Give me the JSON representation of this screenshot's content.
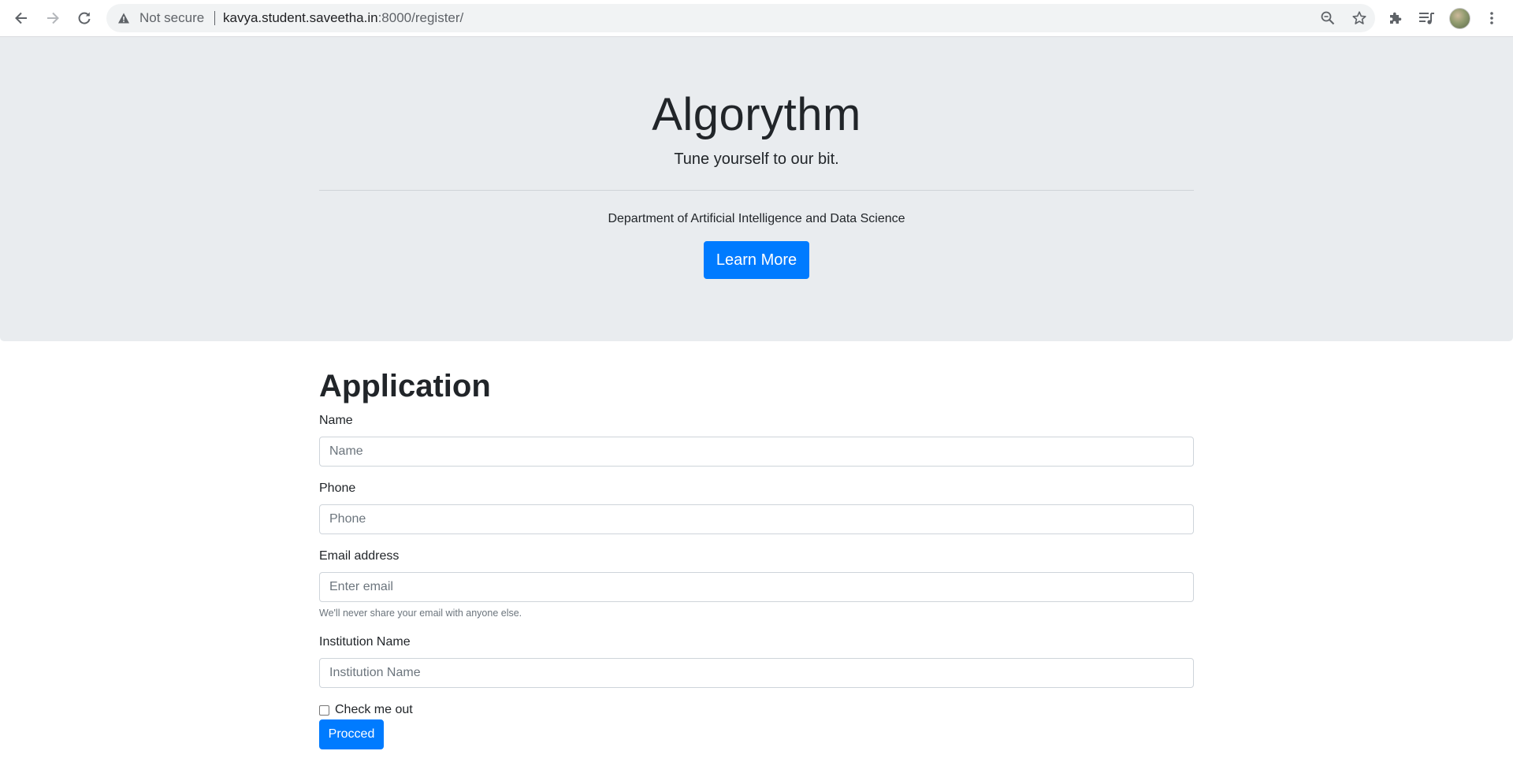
{
  "browser": {
    "security_label": "Not secure",
    "url_host": "kavya.student.saveetha.in",
    "url_rest": ":8000/register/",
    "icons": [
      "back-icon",
      "forward-icon",
      "reload-icon",
      "warning-icon",
      "zoom-icon",
      "star-icon",
      "extensions-icon",
      "media-icon",
      "avatar",
      "menu-icon"
    ]
  },
  "jumbotron": {
    "title": "Algorythm",
    "lead": "Tune yourself to our bit.",
    "department": "Department of Artificial Intelligence and Data Science",
    "learn_more_label": "Learn More"
  },
  "form": {
    "heading": "Application",
    "name": {
      "label": "Name",
      "placeholder": "Name",
      "value": ""
    },
    "phone": {
      "label": "Phone",
      "placeholder": "Phone",
      "value": ""
    },
    "email": {
      "label": "Email address",
      "placeholder": "Enter email",
      "value": "",
      "help": "We'll never share your email with anyone else."
    },
    "institution": {
      "label": "Institution Name",
      "placeholder": "Institution Name",
      "value": ""
    },
    "checkbox": {
      "label": "Check me out",
      "checked": false
    },
    "submit_label": "Procced"
  },
  "colors": {
    "primary": "#007bff",
    "jumbotron_bg": "#e9ecef",
    "text": "#212529",
    "muted": "#6c757d",
    "input_border": "#ced4da"
  }
}
